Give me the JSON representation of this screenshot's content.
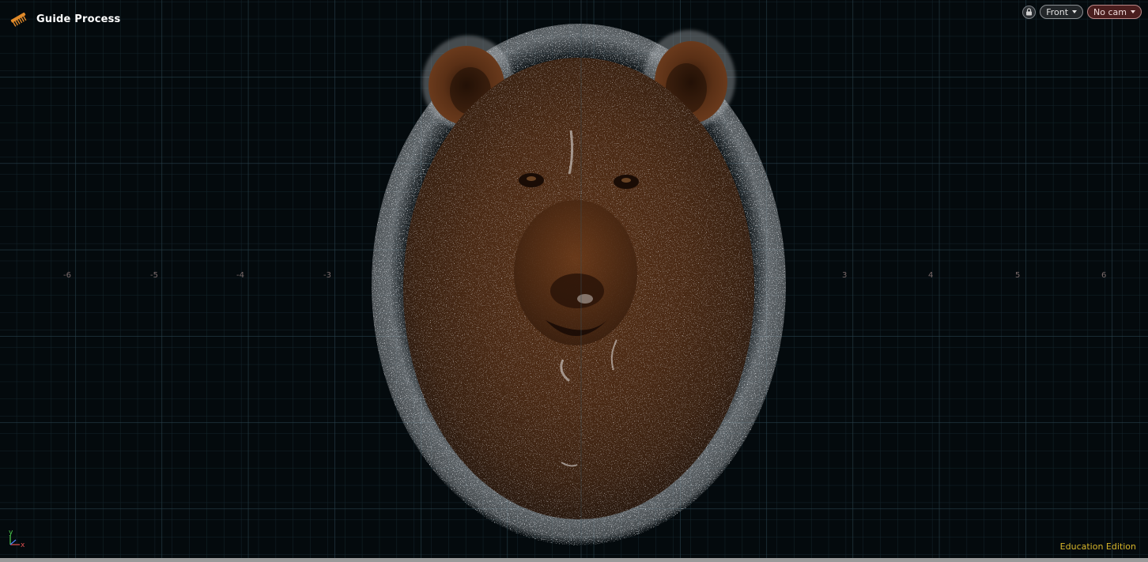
{
  "viewport": {
    "title": "Guide Process",
    "title_icon": "comb-icon",
    "view_label": "Front",
    "camera_label": "No cam",
    "lock_icon": "lock-icon",
    "edition_label": "Education Edition",
    "axis_labels": {
      "y": "y",
      "x": "x"
    },
    "grid_ticks": [
      "-6",
      "-5",
      "-4",
      "-3",
      "3",
      "4",
      "5",
      "6"
    ]
  },
  "colors": {
    "background": "#040a0d",
    "grid_minor": "#1a2e36",
    "grid_major": "#2f4a55",
    "fur_base": "#4a2a16",
    "guide_hair": "#c8ccd0",
    "edition_text": "#d7b62a",
    "nocam_button": "#4a1e1e"
  }
}
